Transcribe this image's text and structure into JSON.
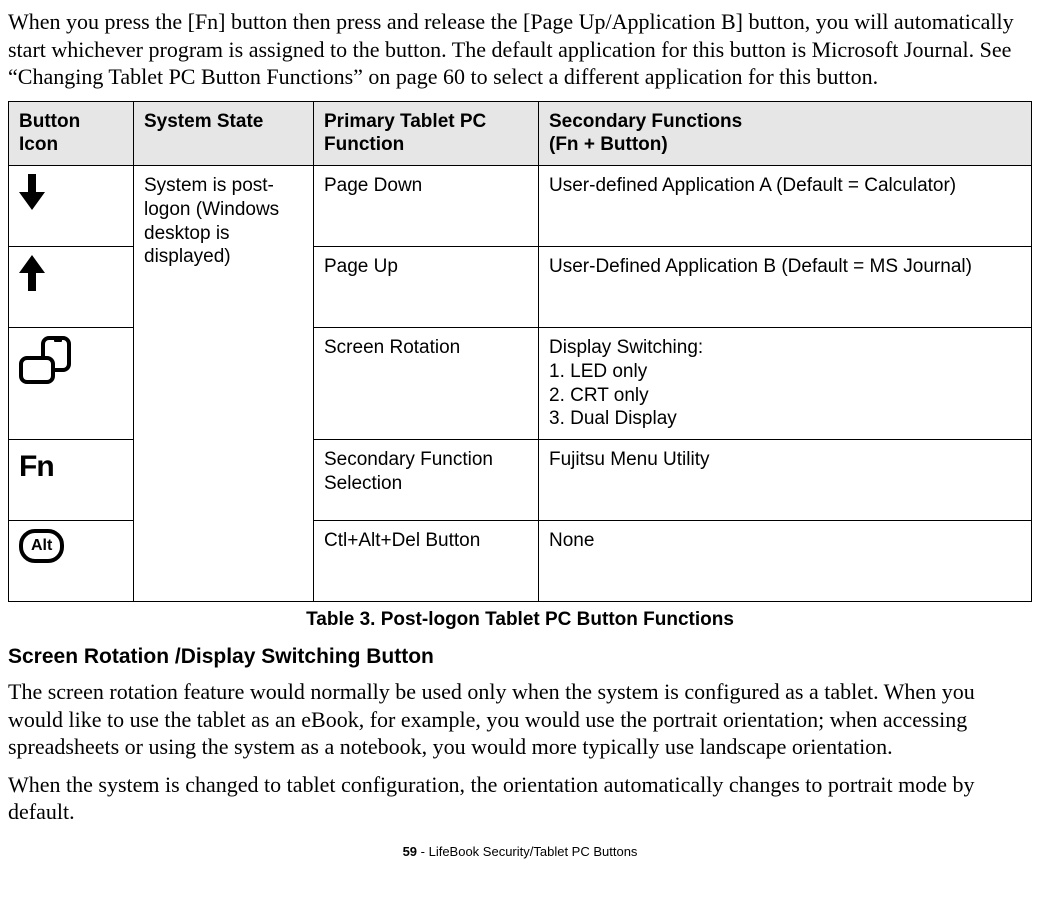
{
  "intro_paragraph": "When you press the [Fn] button then press and release the [Page Up/Application B] button, you will automatically start whichever program is assigned to the button. The default application for this button is Microsoft Journal. See “Changing Tablet PC Button Functions” on page 60 to select a different application for this button.",
  "table": {
    "headers": {
      "icon": "Button Icon",
      "state": "System State",
      "primary": "Primary Tablet PC Function",
      "secondary_line1": "Secondary Functions",
      "secondary_line2": "(Fn + Button)"
    },
    "state_text": "System is post-logon (Windows desktop is displayed)",
    "rows": [
      {
        "icon": "arrow-down",
        "primary": "Page Down",
        "secondary": "User-defined Application A (Default = Calculator)"
      },
      {
        "icon": "arrow-up",
        "primary": "Page Up",
        "secondary": "User-Defined Application B (Default = MS Journal)"
      },
      {
        "icon": "rotation",
        "primary": "Screen Rotation",
        "secondary_lines": [
          "Display Switching:",
          "1. LED only",
          "2. CRT only",
          "3. Dual Display"
        ]
      },
      {
        "icon": "fn",
        "fn_label": "Fn",
        "primary": "Secondary Function Selection",
        "secondary": "Fujitsu Menu Utility"
      },
      {
        "icon": "alt",
        "alt_label": "Alt",
        "primary": "Ctl+Alt+Del Button",
        "secondary": "None"
      }
    ],
    "caption": "Table 3.  Post-logon Tablet PC Button Functions"
  },
  "subheading": "Screen Rotation /Display Switching Button",
  "para2": "The screen rotation feature would normally be used only when the system is configured as a tablet. When you would like to use the tablet as an eBook, for example, you would use the portrait orientation; when accessing spreadsheets or using the system as a notebook, you would more typically use landscape orientation.",
  "para3": "When the system is changed to tablet configuration, the orientation automatically changes to portrait mode by default.",
  "footer": {
    "page": "59",
    "sep": " - ",
    "title": "LifeBook Security/Tablet PC Buttons"
  }
}
